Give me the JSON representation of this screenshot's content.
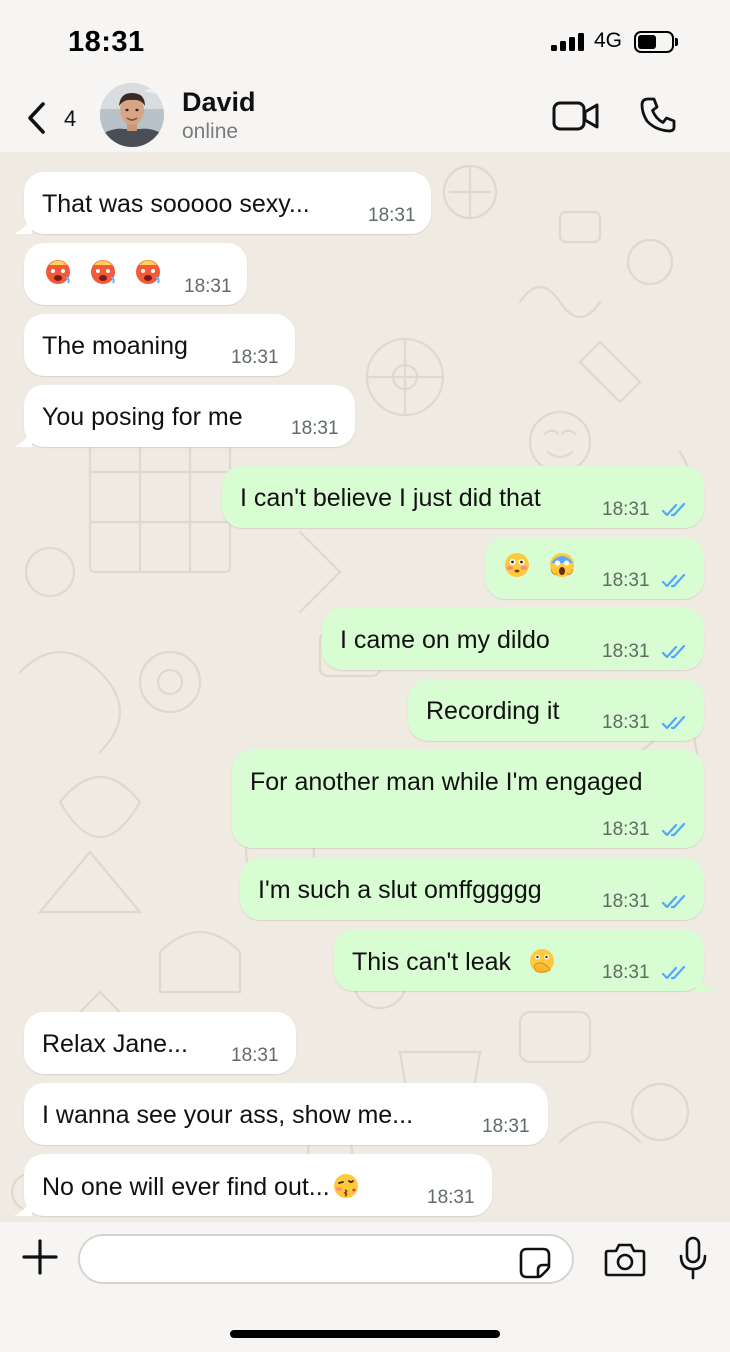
{
  "status_bar": {
    "time": "18:31",
    "network": "4G"
  },
  "header": {
    "back_count": "4",
    "contact_name": "David",
    "contact_status": "online"
  },
  "messages": [
    {
      "dir": "in",
      "text": "That was sooooo sexy...",
      "time": "18:31"
    },
    {
      "dir": "in",
      "text": "",
      "emoji": [
        "hot-face",
        "hot-face",
        "hot-face"
      ],
      "time": "18:31"
    },
    {
      "dir": "in",
      "text": "The moaning",
      "time": "18:31"
    },
    {
      "dir": "in",
      "text": "You posing for me",
      "time": "18:31"
    },
    {
      "dir": "out",
      "text": "I can't believe I just did that",
      "time": "18:31",
      "read": true
    },
    {
      "dir": "out",
      "text": "",
      "emoji": [
        "flushed-face",
        "screaming-face"
      ],
      "time": "18:31",
      "read": true
    },
    {
      "dir": "out",
      "text": "I came on my dildo",
      "time": "18:31",
      "read": true
    },
    {
      "dir": "out",
      "text": "Recording it",
      "time": "18:31",
      "read": true
    },
    {
      "dir": "out",
      "text": "For another man while I'm engaged",
      "time": "18:31",
      "read": true
    },
    {
      "dir": "out",
      "text": "I'm such a slut omffggggg",
      "time": "18:31",
      "read": true
    },
    {
      "dir": "out",
      "text": "This can't leak",
      "emoji": [
        "hand-over-mouth-face"
      ],
      "time": "18:31",
      "read": true
    },
    {
      "dir": "in",
      "text": "Relax Jane...",
      "time": "18:31"
    },
    {
      "dir": "in",
      "text": "I wanna see your ass, show me...",
      "time": "18:31"
    },
    {
      "dir": "in",
      "text": "No one will ever find out...",
      "emoji": [
        "face-blowing-kiss"
      ],
      "time": "18:31"
    }
  ],
  "composer": {
    "value": "",
    "placeholder": ""
  },
  "colors": {
    "incoming_bubble": "#ffffff",
    "outgoing_bubble": "#d9fdd3",
    "read_ticks": "#53a6fd",
    "wallpaper": "#efeae2"
  },
  "icons": [
    "back-chevron-icon",
    "video-call-icon",
    "phone-call-icon",
    "plus-icon",
    "sticker-icon",
    "camera-icon",
    "microphone-icon"
  ]
}
